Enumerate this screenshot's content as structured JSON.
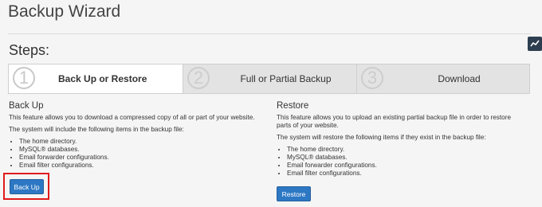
{
  "page": {
    "title": "Backup Wizard",
    "steps_heading": "Steps:"
  },
  "steps": [
    {
      "number": "1",
      "label": "Back Up or Restore",
      "active": true
    },
    {
      "number": "2",
      "label": "Full or Partial Backup",
      "active": false
    },
    {
      "number": "3",
      "label": "Download",
      "active": false
    }
  ],
  "backup": {
    "heading": "Back Up",
    "description": "This feature allows you to download a compressed copy of all or part of your website.",
    "include_text": "The system will include the following items in the backup file:",
    "items": [
      "The home directory.",
      "MySQL® databases.",
      "Email forwarder configurations.",
      "Email filter configurations."
    ],
    "button_label": "Back Up"
  },
  "restore": {
    "heading": "Restore",
    "description": "This feature allows you to upload an existing partial backup file in order to restore parts of your website.",
    "include_text": "The system will restore the following items if they exist in the backup file:",
    "items": [
      "The home directory.",
      "MySQL® databases.",
      "Email forwarder configurations.",
      "Email filter configurations."
    ],
    "button_label": "Restore"
  },
  "colors": {
    "primary_button": "#2d78c4",
    "highlight_border": "#e01b1b",
    "side_icon": "#2d3e50"
  },
  "icons": {
    "side": "chart-icon"
  }
}
